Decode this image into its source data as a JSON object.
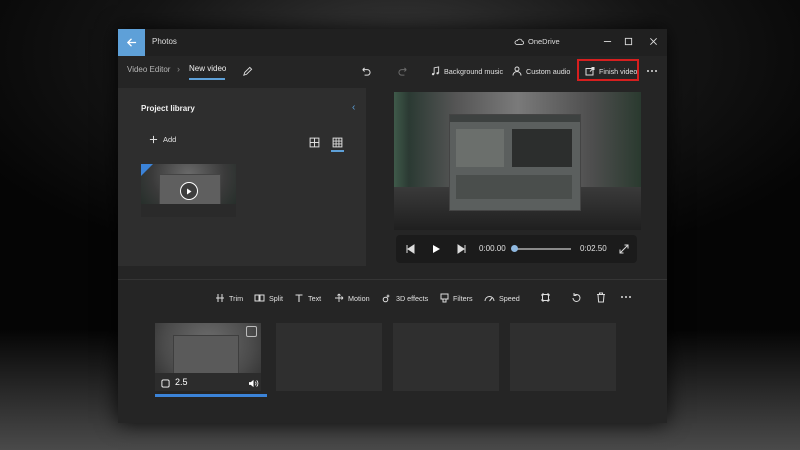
{
  "window": {
    "app_title": "Photos",
    "cloud_label": "OneDrive",
    "controls": [
      "minimize-icon",
      "maximize-icon",
      "close-icon"
    ]
  },
  "toolbar": {
    "breadcrumb_root": "Video Editor",
    "breadcrumb_current": "New video",
    "background_music_label": "Background music",
    "custom_audio_label": "Custom audio",
    "finish_video_label": "Finish video",
    "highlight_color": "#d61f1f"
  },
  "library": {
    "title": "Project library",
    "add_label": "Add"
  },
  "player": {
    "current_time": "0:00.00",
    "total_time": "0:02.50",
    "progress": 0
  },
  "edit_tools": {
    "trim": "Trim",
    "split": "Split",
    "text": "Text",
    "motion": "Motion",
    "effects": "3D effects",
    "filters": "Filters",
    "speed": "Speed"
  },
  "storyboard": {
    "clips": [
      {
        "duration": "2.5",
        "selected": true
      }
    ],
    "empty_slots": 3
  },
  "colors": {
    "accent": "#5ea0d8",
    "selection": "#3b83d8"
  }
}
